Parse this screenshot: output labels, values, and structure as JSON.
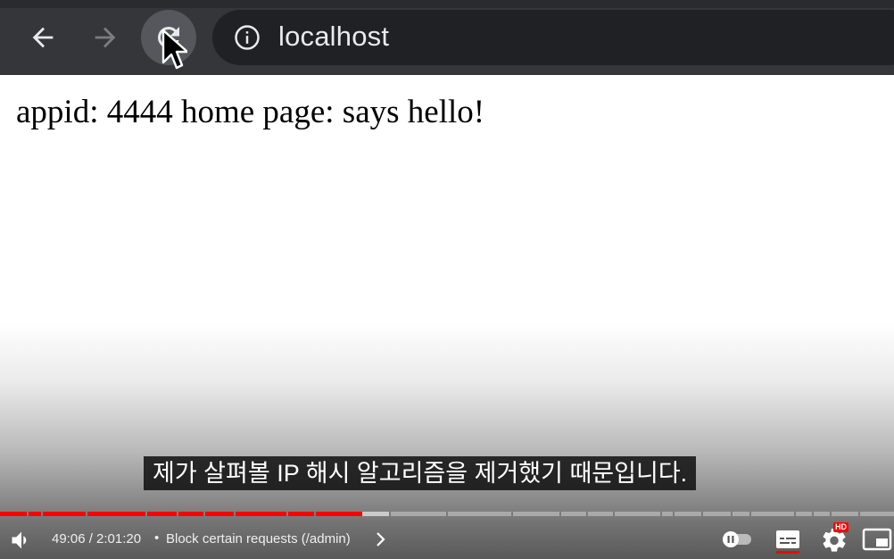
{
  "browser": {
    "url": "localhost",
    "back_icon": "arrow-left-icon",
    "forward_icon": "arrow-right-icon",
    "reload_icon": "reload-icon",
    "info_icon": "info-icon"
  },
  "page": {
    "body_text": "appid: 4444 home page: says hello!"
  },
  "player": {
    "caption": "제가 살펴볼 IP 해시 알고리즘을 제거했기 때문입니다.",
    "time_display": "49:06 / 2:01:20",
    "separator": "•",
    "chapter_title": "Block certain requests (/admin)",
    "settings_badge": "HD",
    "progress_fraction": 0.405,
    "colors": {
      "played": "#ff0000",
      "toolbar": "#35363a",
      "omnibox": "#202124"
    },
    "icons": [
      "volume-icon",
      "chevron-right-icon",
      "autoplay-toggle-icon",
      "subtitles-icon",
      "settings-gear-icon",
      "miniplayer-icon"
    ]
  }
}
